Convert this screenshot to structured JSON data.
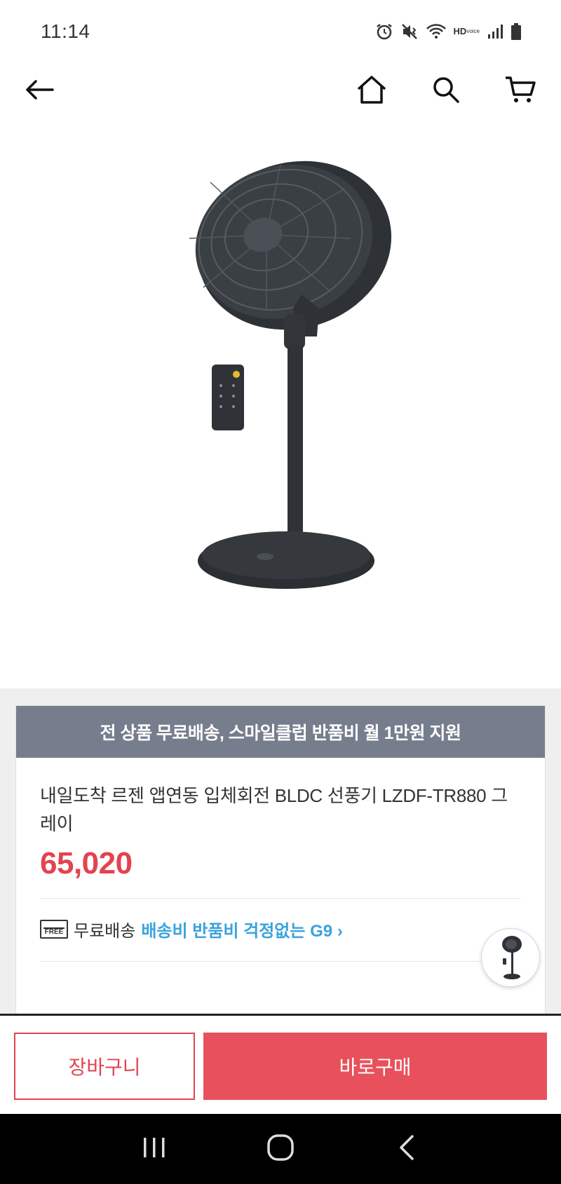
{
  "status_bar": {
    "time": "11:14",
    "hd_label": "HD",
    "voice_label": "voice",
    "icons": [
      "alarm-icon",
      "mute-vibrate-icon",
      "wifi-icon",
      "hd-voice-icon",
      "signal-icon",
      "battery-icon"
    ]
  },
  "app_bar": {
    "icons": [
      "back-arrow-icon",
      "home-icon",
      "search-icon",
      "cart-icon"
    ]
  },
  "product": {
    "image_alt": "fan-product-image",
    "promo_banner": "전 상품 무료배송, 스마일클럽 반품비 월 1만원 지원",
    "title": "내일도착 르젠 앱연동 입체회전 BLDC 선풍기 LZDF-TR880 그레이",
    "price": "65,020"
  },
  "shipping": {
    "free_icon_text": "FREE",
    "label": "무료배송",
    "link": "배송비 반품비 걱정없는 G9 ›"
  },
  "bottom_bar": {
    "cart_label": "장바구니",
    "buy_label": "바로구매"
  },
  "colors": {
    "accent": "#e3434f",
    "buy_button": "#e8505b",
    "banner": "#767d8c",
    "link": "#3aa2dd"
  }
}
